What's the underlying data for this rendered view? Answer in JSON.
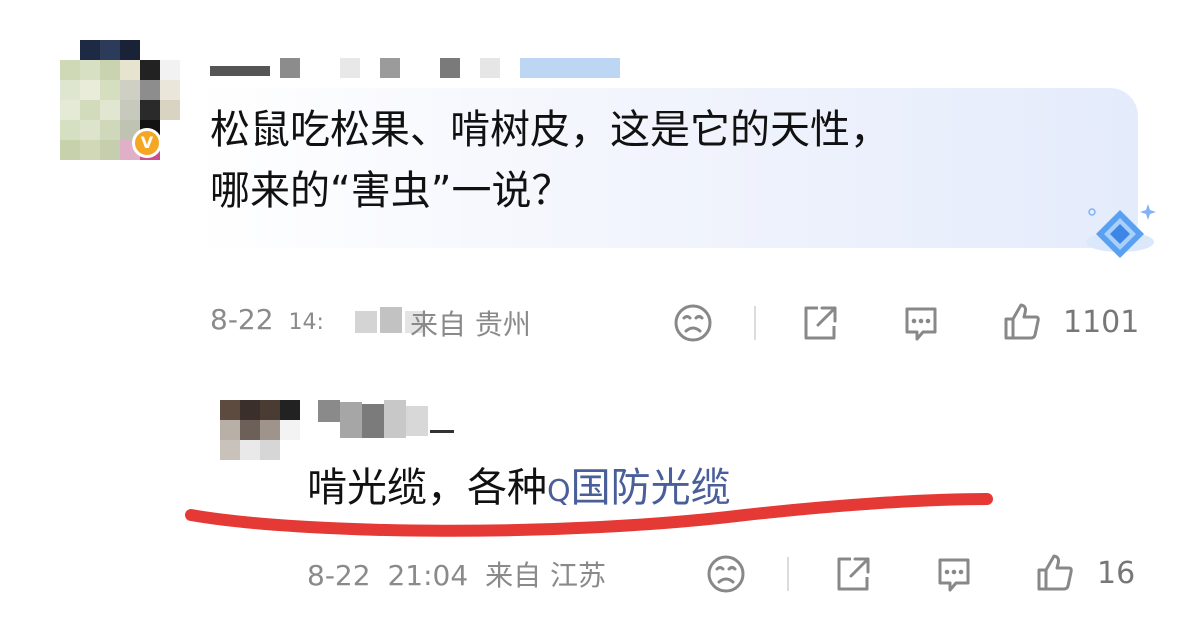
{
  "comment": {
    "verified_badge": "V",
    "text_line1": "松鼠吃松果、啃树皮，这是它的天性，",
    "text_line2": "哪来的“害虫”一说？",
    "date": "8-22",
    "time_partial": "14:",
    "source": "来自 贵州",
    "like_count": "1101",
    "icons": [
      "dislike-icon",
      "share-icon",
      "comment-icon",
      "like-icon",
      "diamond-badge-icon"
    ]
  },
  "reply": {
    "text_prefix": "啃光缆，各种",
    "search_glyph": "Q",
    "link_text": "国防光缆",
    "date": "8-22",
    "time": "21:04",
    "source": "来自 江苏",
    "like_count": "16"
  },
  "colors": {
    "link": "#4a5f9a",
    "meta_text": "#8a8a8a",
    "badge": "#f5a623",
    "annotation_red": "#e53935"
  }
}
